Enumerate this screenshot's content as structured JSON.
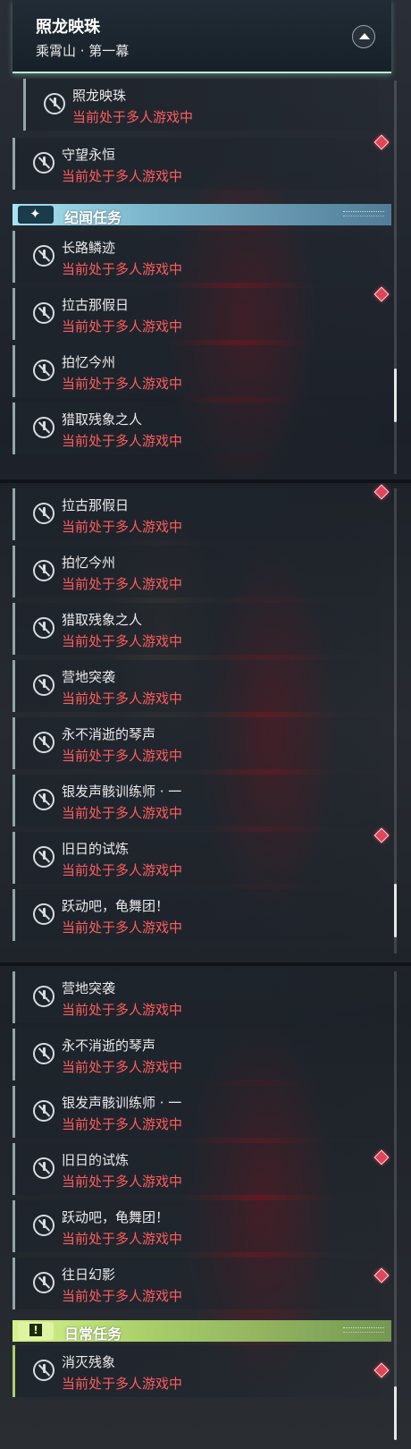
{
  "header": {
    "title": "照龙映珠",
    "subtitle": "乘霄山 · 第一幕"
  },
  "category_lore": {
    "label": "纪闻任务"
  },
  "category_daily": {
    "label": "日常任务"
  },
  "status_text": "当前处于多人游戏中",
  "panel1": {
    "quests": [
      {
        "name": "照龙映珠",
        "status": "当前处于多人游戏中"
      },
      {
        "name": "守望永恒",
        "status": "当前处于多人游戏中"
      },
      {
        "name": "长路鳞迹",
        "status": "当前处于多人游戏中"
      },
      {
        "name": "拉古那假日",
        "status": "当前处于多人游戏中"
      },
      {
        "name": "拍忆今州",
        "status": "当前处于多人游戏中"
      },
      {
        "name": "猎取残象之人",
        "status": "当前处于多人游戏中"
      }
    ]
  },
  "panel2": {
    "quests": [
      {
        "name": "拉古那假日",
        "status": "当前处于多人游戏中"
      },
      {
        "name": "拍忆今州",
        "status": "当前处于多人游戏中"
      },
      {
        "name": "猎取残象之人",
        "status": "当前处于多人游戏中"
      },
      {
        "name": "营地突袭",
        "status": "当前处于多人游戏中"
      },
      {
        "name": "永不消逝的琴声",
        "status": "当前处于多人游戏中"
      },
      {
        "name": "银发声骸训练师 · 一",
        "status": "当前处于多人游戏中"
      },
      {
        "name": "旧日的试炼",
        "status": "当前处于多人游戏中"
      },
      {
        "name": "跃动吧，龟舞团！",
        "status": "当前处于多人游戏中"
      }
    ]
  },
  "panel3": {
    "quests": [
      {
        "name": "营地突袭",
        "status": "当前处于多人游戏中"
      },
      {
        "name": "永不消逝的琴声",
        "status": "当前处于多人游戏中"
      },
      {
        "name": "银发声骸训练师 · 一",
        "status": "当前处于多人游戏中"
      },
      {
        "name": "旧日的试炼",
        "status": "当前处于多人游戏中"
      },
      {
        "name": "跃动吧，龟舞团！",
        "status": "当前处于多人游戏中"
      },
      {
        "name": "往日幻影",
        "status": "当前处于多人游戏中"
      },
      {
        "name": "消灭残象",
        "status": "当前处于多人游戏中"
      }
    ]
  },
  "colors": {
    "status_red": "#ff5c5c",
    "lore_accent": "#a8e4f0",
    "daily_accent": "#d6f28c",
    "header_accent": "#b9f0d6",
    "marker": "#e0465a"
  },
  "icons": {
    "quest_icon": "no-entry-circle-icon",
    "marker_icon": "red-diamond-marker-icon",
    "lore_badge": "sparkle-icon",
    "daily_badge": "exclamation-icon",
    "collapse": "chevron-up-icon"
  }
}
